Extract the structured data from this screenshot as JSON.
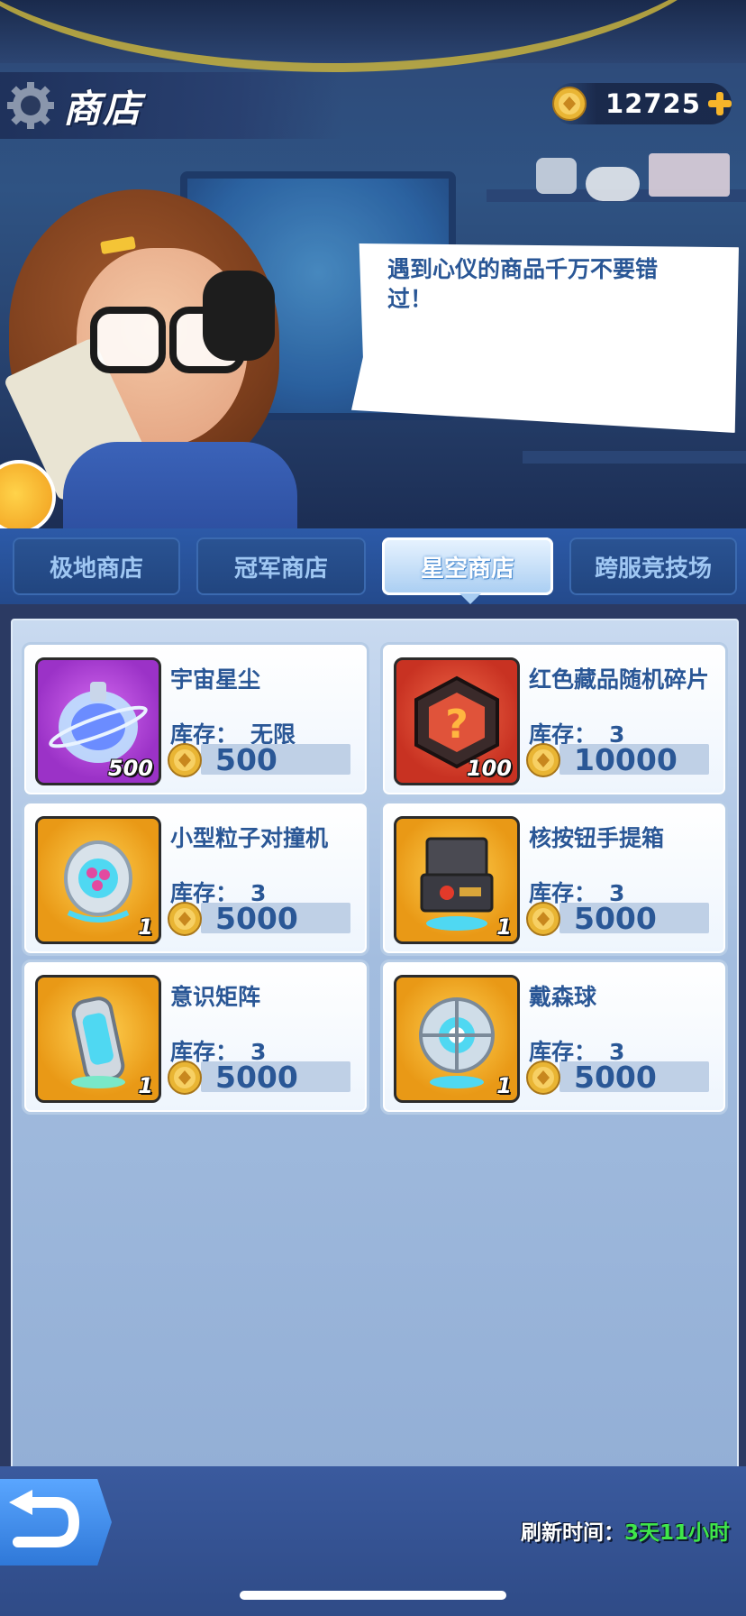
{
  "header": {
    "title": "商店",
    "currency_amount": "12725"
  },
  "dialog": {
    "text": "遇到心仪的商品千万不要错过！"
  },
  "tabs": [
    {
      "label": "极地商店",
      "active": false
    },
    {
      "label": "冠军商店",
      "active": false
    },
    {
      "label": "星空商店",
      "active": true
    },
    {
      "label": "跨服竞技场",
      "active": false
    }
  ],
  "items": [
    {
      "name": "宇宙星尘",
      "stock_label": "库存：",
      "stock": "无限",
      "price": "500",
      "qty": "500",
      "color": "#9b32c7"
    },
    {
      "name": "红色藏品随机碎片",
      "stock_label": "库存：",
      "stock": "3",
      "price": "10000",
      "qty": "100",
      "color": "#c83222"
    },
    {
      "name": "小型粒子对撞机",
      "stock_label": "库存：",
      "stock": "3",
      "price": "5000",
      "qty": "1",
      "color": "#e99916"
    },
    {
      "name": "核按钮手提箱",
      "stock_label": "库存：",
      "stock": "3",
      "price": "5000",
      "qty": "1",
      "color": "#e99916"
    },
    {
      "name": "意识矩阵",
      "stock_label": "库存：",
      "stock": "3",
      "price": "5000",
      "qty": "1",
      "color": "#e99916"
    },
    {
      "name": "戴森球",
      "stock_label": "库存：",
      "stock": "3",
      "price": "5000",
      "qty": "1",
      "color": "#e99916"
    }
  ],
  "footer": {
    "refresh_label": "刷新时间：",
    "refresh_time": "3天11小时"
  },
  "colors": {
    "text_blue": "#2a5796",
    "refresh_green": "#3fe64a",
    "active_tab": "#a8cdf2"
  },
  "icons": {
    "title": "gear-icon",
    "currency": "coin-icon",
    "add_currency": "plus-icon",
    "back": "back-arrow-icon"
  }
}
